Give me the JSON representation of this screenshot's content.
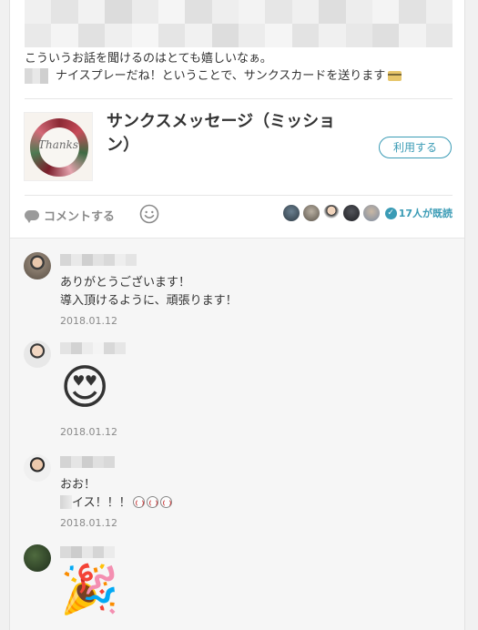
{
  "post": {
    "text_line1": "こういうお話を聞けるのはとても嬉しいなぁ。",
    "text_line2": "ナイスプレーだね！ということで、サンクスカードを送ります"
  },
  "message_card": {
    "image_text": "Thanks",
    "title": "サンクスメッセージ（ミッション）",
    "use_button": "利用する"
  },
  "actions": {
    "comment_label": "コメントする",
    "read_count": "17人が既読"
  },
  "comments": [
    {
      "line1": "ありがとうございます！",
      "line2": "導入頂けるように、頑張ります！",
      "date": "2018.01.12"
    },
    {
      "emoji": "😍",
      "date": "2018.01.12"
    },
    {
      "line1": "おお！",
      "line2_suffix": "イス！！！",
      "date": "2018.01.12"
    },
    {
      "emoji": "🎉"
    }
  ],
  "colors": {
    "accent": "#3a9bb5",
    "muted": "#8a8a8a",
    "text": "#333333"
  }
}
